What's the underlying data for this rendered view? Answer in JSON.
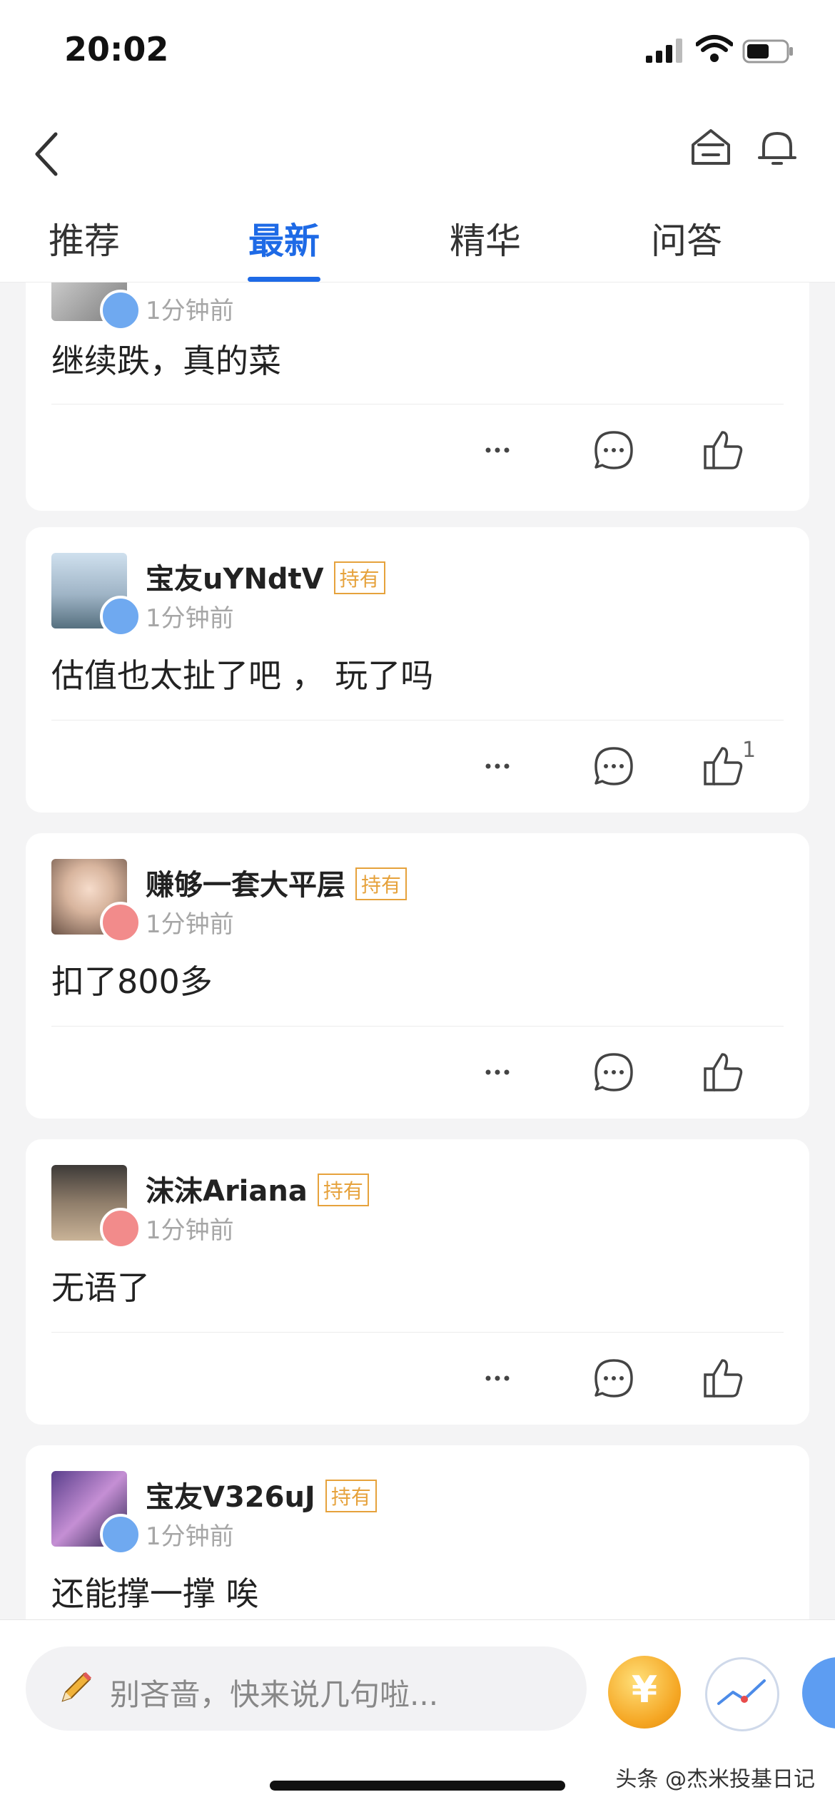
{
  "status": {
    "time": "20:02"
  },
  "header": {
    "tabs": [
      {
        "label": "推荐",
        "active": false
      },
      {
        "label": "最新",
        "active": true
      },
      {
        "label": "精华",
        "active": false
      },
      {
        "label": "问答",
        "active": false
      }
    ],
    "accent": "#1e6ae6"
  },
  "posts": [
    {
      "name": "",
      "holding": "",
      "time": "1分钟前",
      "content": "继续跌，真的菜",
      "likes": ""
    },
    {
      "name": "宝友uYNdtV",
      "holding": "持有",
      "time": "1分钟前",
      "content": "估值也太扯了吧 ， 玩了吗",
      "likes": "1"
    },
    {
      "name": "赚够一套大平层",
      "holding": "持有",
      "time": "1分钟前",
      "content": "扣了800多",
      "likes": ""
    },
    {
      "name": "沫沫Ariana",
      "holding": "持有",
      "time": "1分钟前",
      "content": "无语了",
      "likes": ""
    },
    {
      "name": "宝友V326uJ",
      "holding": "持有",
      "time": "1分钟前",
      "content": "还能撑一撑 唉",
      "likes": ""
    }
  ],
  "bottom": {
    "placeholder": "别吝啬，快来说几句啦...",
    "coin_symbol": "¥",
    "watermark": "头条 @杰米投基日记"
  }
}
